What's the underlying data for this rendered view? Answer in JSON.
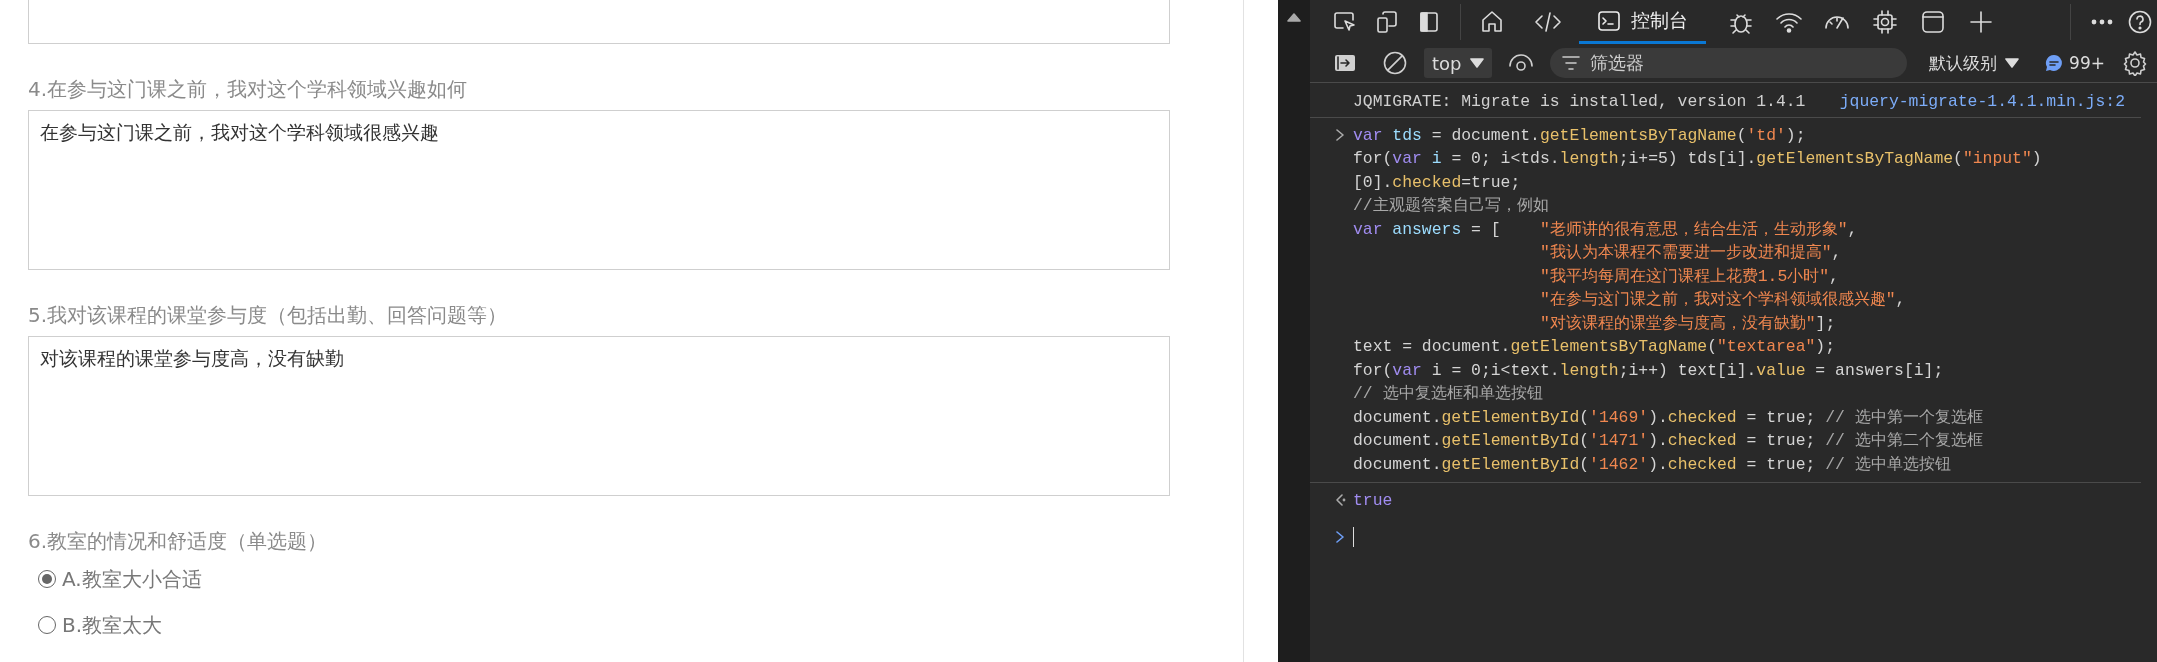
{
  "survey": {
    "questions": [
      {
        "kind": "text"
      },
      {
        "kind": "text",
        "title": "4.在参与这门课之前，我对这个学科领域兴趣如何",
        "value": "在参与这门课之前，我对这个学科领域很感兴趣"
      },
      {
        "kind": "text",
        "title": "5.我对该课程的课堂参与度（包括出勤、回答问题等）",
        "value": "对该课程的课堂参与度高，没有缺勤"
      },
      {
        "kind": "single",
        "title": "6.教室的情况和舒适度（单选题）",
        "options": [
          {
            "label": "A.教室大小合适",
            "selected": true
          },
          {
            "label": "B.教室太大",
            "selected": false
          }
        ]
      }
    ]
  },
  "devtools": {
    "tab": {
      "label": "控制台",
      "selected": true
    },
    "toolbar": {
      "context": "top",
      "filter": {
        "placeholder": "筛选器"
      },
      "level": "默认级别",
      "message_count": "99+"
    },
    "console": [
      {
        "kind": "log",
        "text": "JQMIGRATE: Migrate is installed, version 1.4.1",
        "source": "jquery-migrate-1.4.1.min.js:2"
      },
      {
        "kind": "input",
        "lines": [
          {
            "kind": "first",
            "segments": [
              {
                "t": "var ",
                "kind": "keyword"
              },
              {
                "t": "tds",
                "kind": "variable"
              },
              {
                "t": " = document.",
                "kind": "plain"
              },
              {
                "t": "getElementsByTagName",
                "kind": "method"
              },
              {
                "t": "(",
                "kind": "plain"
              },
              {
                "t": "'td'",
                "kind": "string"
              },
              {
                "t": ");",
                "kind": "plain"
              }
            ]
          },
          {
            "kind": "line",
            "segments": [
              {
                "t": "for(",
                "kind": "plain"
              },
              {
                "t": "var ",
                "kind": "keyword"
              },
              {
                "t": "i",
                "kind": "variable"
              },
              {
                "t": " = 0; i<tds.",
                "kind": "plain"
              },
              {
                "t": "length",
                "kind": "method"
              },
              {
                "t": ";i+=5) tds[i].",
                "kind": "plain"
              },
              {
                "t": "getElementsByTagName",
                "kind": "method"
              },
              {
                "t": "(",
                "kind": "plain"
              },
              {
                "t": "\"input\"",
                "kind": "string"
              },
              {
                "t": ")",
                "kind": "plain"
              }
            ]
          },
          {
            "kind": "line",
            "segments": [
              {
                "t": "[0].",
                "kind": "plain"
              },
              {
                "t": "checked",
                "kind": "method"
              },
              {
                "t": "=true;",
                "kind": "plain"
              }
            ]
          },
          {
            "kind": "line",
            "segments": [
              {
                "t": "//主观题答案自己写，例如",
                "kind": "comment"
              }
            ]
          },
          {
            "kind": "line",
            "segments": [
              {
                "t": "var ",
                "kind": "keyword"
              },
              {
                "t": "answers",
                "kind": "variable"
              },
              {
                "t": " = [    ",
                "kind": "plain"
              },
              {
                "t": "\"老师讲的很有意思，结合生活，生动形象\"",
                "kind": "string"
              },
              {
                "t": ",",
                "kind": "plain"
              }
            ]
          },
          {
            "kind": "item",
            "segments": [
              {
                "t": "\"我认为本课程不需要进一步改进和提高\"",
                "kind": "string"
              },
              {
                "t": ",",
                "kind": "plain"
              }
            ]
          },
          {
            "kind": "item",
            "segments": [
              {
                "t": "\"我平均每周在这门课程上花费1.5小时\"",
                "kind": "string"
              },
              {
                "t": ",",
                "kind": "plain"
              }
            ]
          },
          {
            "kind": "item",
            "segments": [
              {
                "t": "\"在参与这门课之前，我对这个学科领域很感兴趣\"",
                "kind": "string"
              },
              {
                "t": ",",
                "kind": "plain"
              }
            ]
          },
          {
            "kind": "item",
            "segments": [
              {
                "t": "\"对该课程的课堂参与度高，没有缺勤\"",
                "kind": "string"
              },
              {
                "t": "];",
                "kind": "plain"
              }
            ]
          },
          {
            "kind": "line",
            "segments": [
              {
                "t": "text = document.",
                "kind": "plain"
              },
              {
                "t": "getElementsByTagName",
                "kind": "method"
              },
              {
                "t": "(",
                "kind": "plain"
              },
              {
                "t": "\"textarea\"",
                "kind": "string"
              },
              {
                "t": ");",
                "kind": "plain"
              }
            ]
          },
          {
            "kind": "line",
            "segments": [
              {
                "t": "for(",
                "kind": "plain"
              },
              {
                "t": "var",
                "kind": "keyword"
              },
              {
                "t": " i = 0;i<text.",
                "kind": "plain"
              },
              {
                "t": "length",
                "kind": "method"
              },
              {
                "t": ";i++) text[i].",
                "kind": "plain"
              },
              {
                "t": "value",
                "kind": "method"
              },
              {
                "t": " = answers[i];",
                "kind": "plain"
              }
            ]
          },
          {
            "kind": "line",
            "segments": [
              {
                "t": "// 选中复选框和单选按钮",
                "kind": "comment"
              }
            ]
          },
          {
            "kind": "line",
            "segments": [
              {
                "t": "document.",
                "kind": "plain"
              },
              {
                "t": "getElementById",
                "kind": "method"
              },
              {
                "t": "(",
                "kind": "plain"
              },
              {
                "t": "'1469'",
                "kind": "string"
              },
              {
                "t": ").",
                "kind": "plain"
              },
              {
                "t": "checked",
                "kind": "method"
              },
              {
                "t": " = true; ",
                "kind": "plain"
              },
              {
                "t": "// 选中第一个复选框",
                "kind": "comment"
              }
            ]
          },
          {
            "kind": "line",
            "segments": [
              {
                "t": "document.",
                "kind": "plain"
              },
              {
                "t": "getElementById",
                "kind": "method"
              },
              {
                "t": "(",
                "kind": "plain"
              },
              {
                "t": "'1471'",
                "kind": "string"
              },
              {
                "t": ").",
                "kind": "plain"
              },
              {
                "t": "checked",
                "kind": "method"
              },
              {
                "t": " = true; ",
                "kind": "plain"
              },
              {
                "t": "// 选中第二个复选框",
                "kind": "comment"
              }
            ]
          },
          {
            "kind": "line",
            "segments": [
              {
                "t": "document.",
                "kind": "plain"
              },
              {
                "t": "getElementById",
                "kind": "method"
              },
              {
                "t": "(",
                "kind": "plain"
              },
              {
                "t": "'1462'",
                "kind": "string"
              },
              {
                "t": ").",
                "kind": "plain"
              },
              {
                "t": "checked",
                "kind": "method"
              },
              {
                "t": " = true; ",
                "kind": "plain"
              },
              {
                "t": "// 选中单选按钮",
                "kind": "comment"
              }
            ]
          }
        ]
      },
      {
        "kind": "result",
        "text": "true"
      },
      {
        "kind": "prompt"
      }
    ]
  }
}
